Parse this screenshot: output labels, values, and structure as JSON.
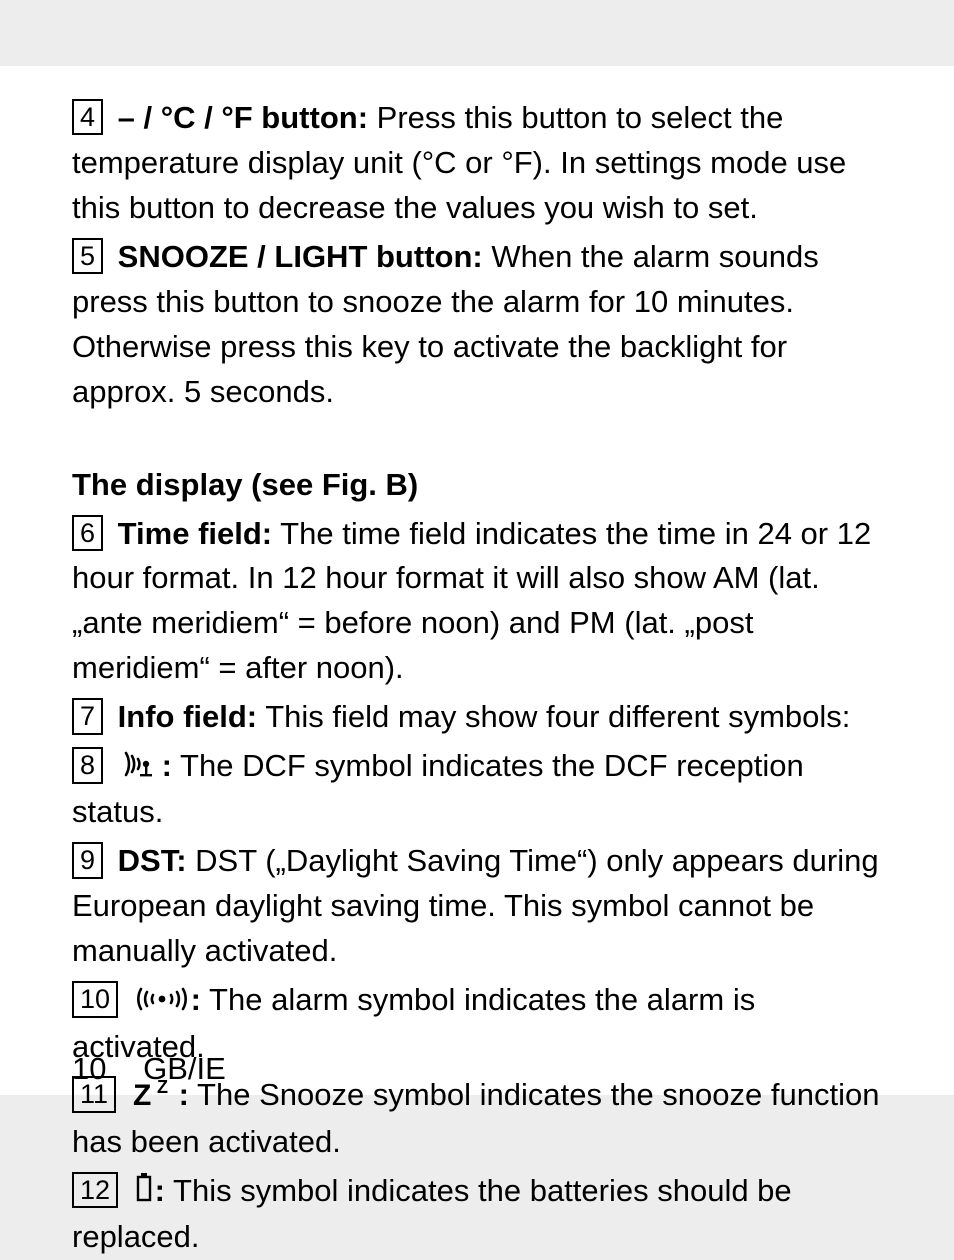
{
  "items": {
    "e4": {
      "num": "4",
      "label": "– / °C / °F button:",
      "text": " Press this button to select the tempera­ture display unit (°C or °F). In settings mode use this button to decrease the values you wish to set."
    },
    "e5": {
      "num": "5",
      "label": "SNOOZE / LIGHT button:",
      "text": " When the alarm sounds press this button to snooze the alarm for 10 minutes. Otherwise press this key to activate the backlight for approx. 5 seconds."
    },
    "heading": "The display (see Fig. B)",
    "e6": {
      "num": "6",
      "label": "Time field:",
      "text": " The time field indicates the time in 24 or 12 hour format. In 12 hour format it will also show AM (lat. „ante meridiem“ = before noon) and PM (lat. „post meridiem“ = after noon)."
    },
    "e7": {
      "num": "7",
      "label": "Info field:",
      "text": " This field may show four different symbols:"
    },
    "e8": {
      "num": "8",
      "iconName": "dcf-signal-icon",
      "colon": ":",
      "text": " The DCF symbol indicates the DCF reception status."
    },
    "e9": {
      "num": "9",
      "label": "DST:",
      "text": " DST („Daylight Saving Time“) only appears during European daylight saving time. This symbol cannot be manually activated."
    },
    "e10": {
      "num": "10",
      "iconName": "alarm-icon",
      "colon": ":",
      "text": " The alarm symbol indicates the alarm is activated."
    },
    "e11": {
      "num": "11",
      "iconName": "snooze-zz-icon",
      "colon": ":",
      "text": " The Snooze symbol indicates the snooze function has been activated."
    },
    "e12": {
      "num": "12",
      "iconName": "battery-icon",
      "colon": ":",
      "text": " This symbol indicates the batteries should be replaced."
    }
  },
  "footer": {
    "page": "10",
    "region": "GB/IE"
  }
}
